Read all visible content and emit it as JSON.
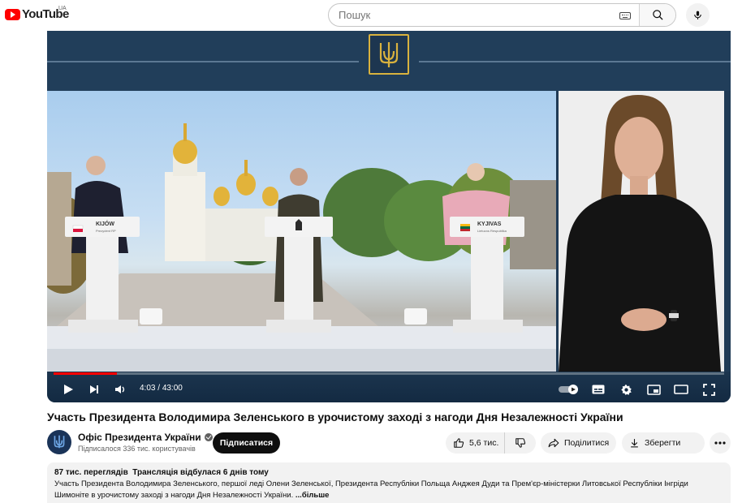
{
  "masthead": {
    "logo_text": "YouTube",
    "region": "UA",
    "search_placeholder": "Пошук"
  },
  "player": {
    "time_current": "4:03",
    "time_separator": " / ",
    "time_total": "43:00",
    "progress_fraction": 0.094,
    "podium_labels": [
      {
        "city": "KIJÓW",
        "sub": "Prezydent RP",
        "flag": "pl"
      },
      {
        "city": "KYJIVAS",
        "sub": "Lietuvos Respublika",
        "flag": "lt"
      }
    ]
  },
  "video": {
    "title": "Участь Президента Володимира Зеленського в урочистому заході з нагоди Дня Незалежності України"
  },
  "channel": {
    "name": "Офіс Президента України",
    "subscribers": "Підписалося 336 тис. користувачів",
    "subscribe_label": "Підписатися"
  },
  "actions": {
    "likes": "5,6 тис.",
    "share_label": "Поділитися",
    "save_label": "Зберегти"
  },
  "description": {
    "views": "87 тис. переглядів",
    "streamed": "Трансляція відбулася 6 днів тому",
    "text": "Участь Президента Володимира Зеленського, першої леді Олени Зеленської, Президента Республіки Польща Анджея Дуди та Прем'єр-міністерки Литовської Республіки Інгріди Шимоніте в урочистому заході з нагоди Дня Незалежності України.",
    "more_label": "...більше"
  },
  "colors": {
    "brand_red": "#ff0000",
    "player_navy": "#213e5a",
    "trident_gold": "#d9b23e"
  }
}
